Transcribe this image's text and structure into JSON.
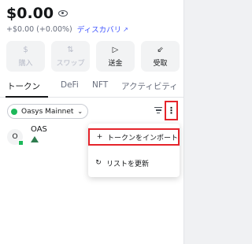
{
  "wallet": {
    "balance": "$0.00",
    "change": "+$0.00 (+0.00%)",
    "discover_label": "ディスカバリ",
    "discover_icon": "external-link-icon"
  },
  "actions": [
    {
      "label": "購入",
      "icon": "dollar-icon",
      "glyph": "$",
      "enabled": false
    },
    {
      "label": "スワップ",
      "icon": "swap-icon",
      "glyph": "⇅",
      "enabled": false
    },
    {
      "label": "送金",
      "icon": "send-icon",
      "glyph": "▷",
      "enabled": true
    },
    {
      "label": "受取",
      "icon": "receive-icon",
      "glyph": "⇙",
      "enabled": true
    }
  ],
  "tabs": [
    {
      "label": "トークン",
      "active": true
    },
    {
      "label": "DeFi",
      "active": false
    },
    {
      "label": "NFT",
      "active": false
    },
    {
      "label": "アクティビティ",
      "active": false
    }
  ],
  "network": {
    "name": "Oasys Mainnet",
    "color": "#1db85a"
  },
  "tokens": [
    {
      "symbol": "OAS",
      "avatar_letter": "O"
    }
  ],
  "menu": {
    "import_label": "トークンをインポート",
    "import_glyph": "+",
    "refresh_label": "リストを更新",
    "refresh_glyph": "↻"
  },
  "colors": {
    "accent": "#4459ff",
    "highlight": "#e5242b",
    "text": "#141618",
    "muted": "#686e7d"
  }
}
